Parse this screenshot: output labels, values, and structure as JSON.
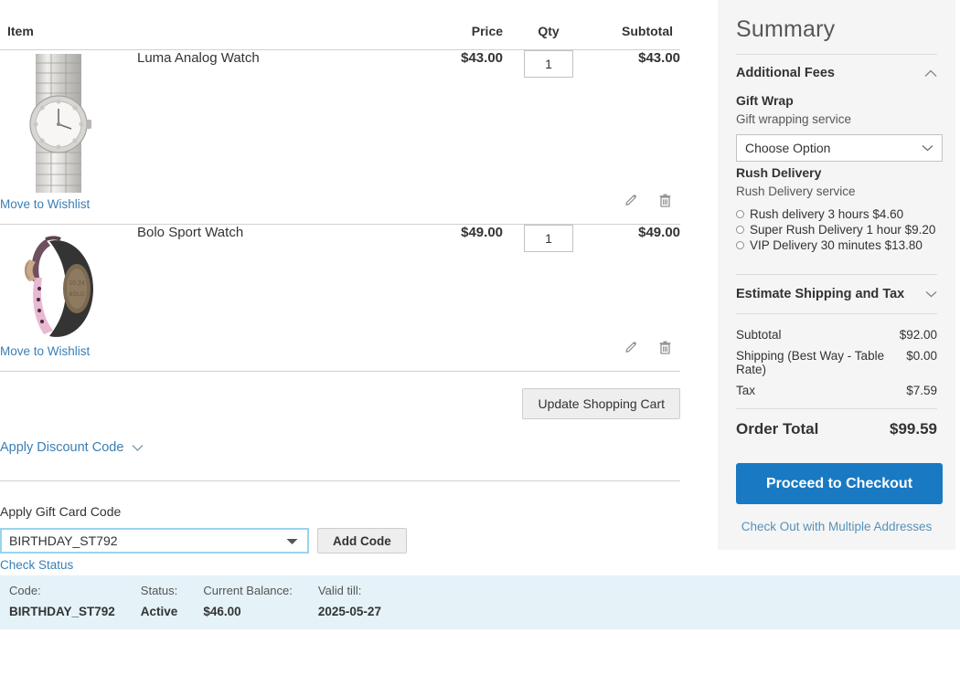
{
  "cart": {
    "columns": {
      "item": "Item",
      "price": "Price",
      "qty": "Qty",
      "subtotal": "Subtotal"
    },
    "items": [
      {
        "name": "Luma Analog Watch",
        "price": "$43.00",
        "qty": "1",
        "subtotal": "$43.00",
        "wishlist_label": "Move to Wishlist",
        "image": "silver-analog-watch"
      },
      {
        "name": "Bolo Sport Watch",
        "price": "$49.00",
        "qty": "1",
        "subtotal": "$49.00",
        "wishlist_label": "Move to Wishlist",
        "image": "pink-sport-watch"
      }
    ],
    "update_button": "Update Shopping Cart",
    "discount_label": "Apply Discount Code"
  },
  "giftcard": {
    "label": "Apply Gift Card Code",
    "value": "BIRTHDAY_ST792",
    "add_button": "Add Code",
    "check_status_label": "Check Status",
    "status_headers": {
      "code": "Code:",
      "status": "Status:",
      "balance": "Current Balance:",
      "valid": "Valid till:"
    },
    "status_values": {
      "code": "BIRTHDAY_ST792",
      "status": "Active",
      "balance": "$46.00",
      "valid": "2025-05-27"
    }
  },
  "summary": {
    "title": "Summary",
    "additional_fees": {
      "label": "Additional Fees",
      "gift_wrap": {
        "title": "Gift Wrap",
        "desc": "Gift wrapping service",
        "select_value": "Choose Option"
      },
      "rush_delivery": {
        "title": "Rush Delivery",
        "desc": "Rush Delivery service",
        "options": [
          "Rush delivery 3 hours $4.60",
          "Super Rush Delivery 1 hour $9.20",
          "VIP Delivery 30 minutes $13.80"
        ]
      }
    },
    "estimate_label": "Estimate Shipping and Tax",
    "totals": [
      {
        "label": "Subtotal",
        "value": "$92.00"
      },
      {
        "label": "Shipping (Best Way - Table Rate)",
        "value": "$0.00"
      },
      {
        "label": "Tax",
        "value": "$7.59"
      }
    ],
    "order_total": {
      "label": "Order Total",
      "value": "$99.59"
    },
    "checkout_button": "Proceed to Checkout",
    "multi_address_link": "Check Out with Multiple Addresses"
  },
  "colors": {
    "accent": "#1979c3",
    "link": "#3a7fb5",
    "panel_bg": "#f5f5f5",
    "status_bg": "#e5f2f8",
    "focus_border": "#9ad4ee"
  }
}
